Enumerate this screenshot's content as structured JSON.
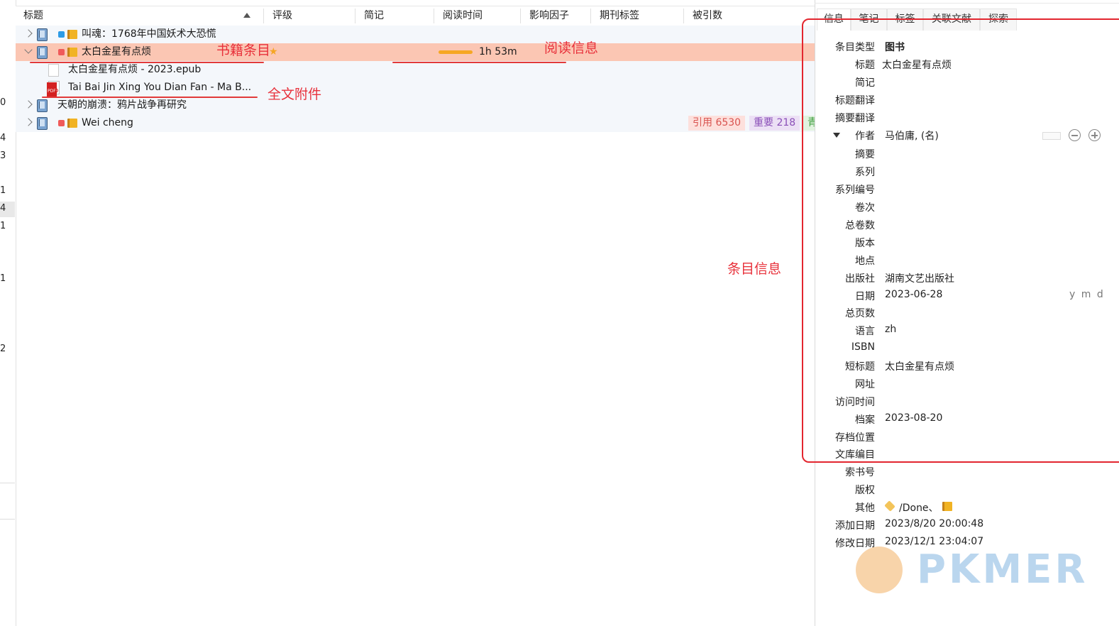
{
  "left_strip": {
    "numbers": [
      "0",
      "4",
      "3",
      "1",
      "4",
      "1",
      "1",
      "2"
    ]
  },
  "header": {
    "columns": [
      "标题",
      "评级",
      "简记",
      "阅读时间",
      "影响因子",
      "期刊标签",
      "被引数"
    ]
  },
  "rows": [
    {
      "title": "叫魂：1768年中国妖术大恐慌",
      "color": "#2d9be6"
    },
    {
      "title": "太白金星有点烦",
      "color": "#f05a5a",
      "reading_time": "1h 53m",
      "reading_progress": 0.35
    },
    {
      "title": "太白金星有点烦 - 2023.epub"
    },
    {
      "title": "Tai Bai Jin Xing You Dian Fan - Ma B..."
    },
    {
      "title": "天朝的崩溃：鸦片战争再研究"
    },
    {
      "title": "Wei cheng",
      "color": "#f05a5a",
      "tags": [
        "引用 6530",
        "重要 218",
        "青"
      ]
    }
  ],
  "annotations": {
    "book_item": "书籍条目",
    "reading_info": "阅读信息",
    "fulltext_attachment": "全文附件",
    "item_info": "条目信息"
  },
  "right_pane": {
    "tabs": [
      "信息",
      "笔记",
      "标签",
      "关联文献",
      "探索"
    ],
    "fields": [
      {
        "label": "条目类型",
        "value": "图书"
      },
      {
        "label": "标题",
        "value": "太白金星有点烦"
      },
      {
        "label": "简记",
        "value": ""
      },
      {
        "label": "标题翻译",
        "value": ""
      },
      {
        "label": "摘要翻译",
        "value": ""
      },
      {
        "label": "作者",
        "value": "马伯庸, (名)"
      },
      {
        "label": "摘要",
        "value": ""
      },
      {
        "label": "系列",
        "value": ""
      },
      {
        "label": "系列编号",
        "value": ""
      },
      {
        "label": "卷次",
        "value": ""
      },
      {
        "label": "总卷数",
        "value": ""
      },
      {
        "label": "版本",
        "value": ""
      },
      {
        "label": "地点",
        "value": ""
      },
      {
        "label": "出版社",
        "value": "湖南文艺出版社"
      },
      {
        "label": "日期",
        "value": "2023-06-28"
      },
      {
        "label": "总页数",
        "value": ""
      },
      {
        "label": "语言",
        "value": "zh"
      },
      {
        "label": "ISBN",
        "value": ""
      },
      {
        "label": "短标题",
        "value": "太白金星有点烦"
      },
      {
        "label": "网址",
        "value": ""
      },
      {
        "label": "访问时间",
        "value": ""
      },
      {
        "label": "档案",
        "value": "2023-08-20"
      },
      {
        "label": "存档位置",
        "value": ""
      },
      {
        "label": "文库编目",
        "value": ""
      },
      {
        "label": "索书号",
        "value": ""
      },
      {
        "label": "版权",
        "value": ""
      },
      {
        "label": "其他",
        "value": "/Done、"
      },
      {
        "label": "添加日期",
        "value": "2023/8/20 20:00:48"
      },
      {
        "label": "修改日期",
        "value": "2023/12/1 23:04:07"
      }
    ],
    "date_format_hint": "y m d"
  },
  "watermark": "PKMER",
  "colors": {
    "selection": "#fbc6b3",
    "annotation_red": "#e8313b",
    "progress": "#f6a723"
  }
}
